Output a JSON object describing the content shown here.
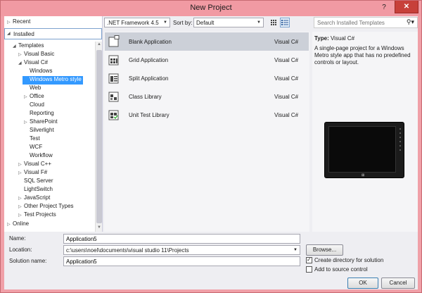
{
  "window": {
    "title": "New Project",
    "help_label": "?",
    "close_label": "✕"
  },
  "tree": {
    "recent": "Recent",
    "installed": "Installed",
    "online": "Online",
    "items": [
      {
        "label": "Templates",
        "indent": 1,
        "expander": "expanded"
      },
      {
        "label": "Visual Basic",
        "indent": 2,
        "expander": "collapsed"
      },
      {
        "label": "Visual C#",
        "indent": 2,
        "expander": "expanded"
      },
      {
        "label": "Windows",
        "indent": 3,
        "expander": "none"
      },
      {
        "label": "Windows Metro style",
        "indent": 3,
        "expander": "none",
        "selected": true
      },
      {
        "label": "Web",
        "indent": 3,
        "expander": "none"
      },
      {
        "label": "Office",
        "indent": 3,
        "expander": "collapsed"
      },
      {
        "label": "Cloud",
        "indent": 3,
        "expander": "none"
      },
      {
        "label": "Reporting",
        "indent": 3,
        "expander": "none"
      },
      {
        "label": "SharePoint",
        "indent": 3,
        "expander": "collapsed"
      },
      {
        "label": "Silverlight",
        "indent": 3,
        "expander": "none"
      },
      {
        "label": "Test",
        "indent": 3,
        "expander": "none"
      },
      {
        "label": "WCF",
        "indent": 3,
        "expander": "none"
      },
      {
        "label": "Workflow",
        "indent": 3,
        "expander": "none"
      },
      {
        "label": "Visual C++",
        "indent": 2,
        "expander": "collapsed"
      },
      {
        "label": "Visual F#",
        "indent": 2,
        "expander": "collapsed"
      },
      {
        "label": "SQL Server",
        "indent": 2,
        "expander": "none"
      },
      {
        "label": "LightSwitch",
        "indent": 2,
        "expander": "none"
      },
      {
        "label": "JavaScript",
        "indent": 2,
        "expander": "collapsed"
      },
      {
        "label": "Other Project Types",
        "indent": 2,
        "expander": "collapsed"
      },
      {
        "label": "Test Projects",
        "indent": 2,
        "expander": "collapsed"
      }
    ]
  },
  "toolbar": {
    "framework": ".NET Framework 4.5",
    "sort_label": "Sort by:",
    "sort_value": "Default",
    "search_placeholder": "Search Installed Templates"
  },
  "templates": [
    {
      "name": "Blank Application",
      "lang": "Visual C#",
      "icon": "blank-app-icon",
      "selected": true
    },
    {
      "name": "Grid Application",
      "lang": "Visual C#",
      "icon": "grid-app-icon"
    },
    {
      "name": "Split Application",
      "lang": "Visual C#",
      "icon": "split-app-icon"
    },
    {
      "name": "Class Library",
      "lang": "Visual C#",
      "icon": "class-library-icon"
    },
    {
      "name": "Unit Test Library",
      "lang": "Visual C#",
      "icon": "unit-test-icon"
    }
  ],
  "details": {
    "type_label": "Type:",
    "type_value": "Visual C#",
    "description": "A single-page project for a Windows Metro style app that has no predefined controls or layout.",
    "logo": "⊞"
  },
  "form": {
    "name_label": "Name:",
    "name_value": "Application5",
    "location_label": "Location:",
    "location_value": "c:\\users\\noel\\documents\\visual studio 11\\Projects",
    "solution_label": "Solution name:",
    "solution_value": "Application5",
    "browse_label": "Browse...",
    "create_dir_label": "Create directory for solution",
    "create_dir_checked": true,
    "source_control_label": "Add to source control",
    "source_control_checked": false,
    "ok_label": "OK",
    "cancel_label": "Cancel"
  }
}
